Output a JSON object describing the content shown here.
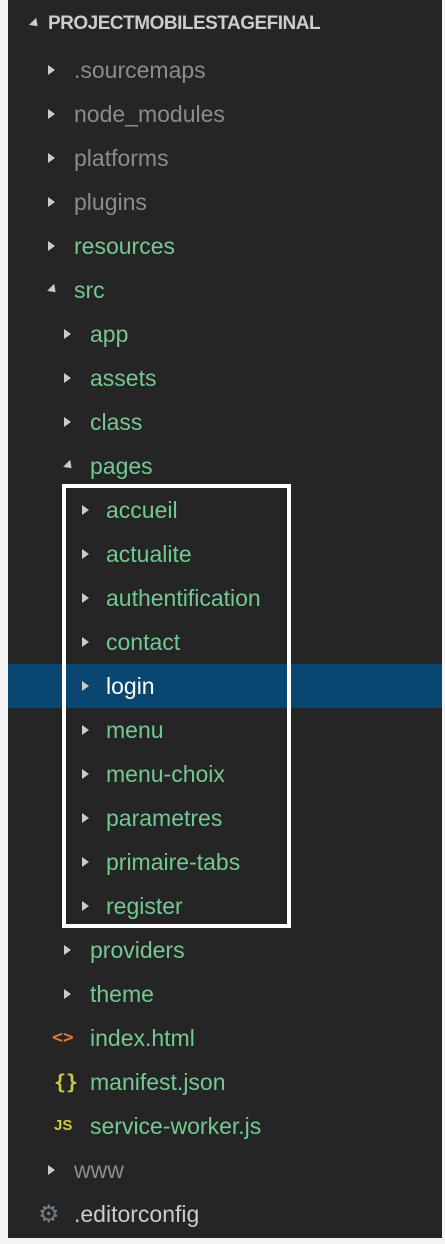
{
  "explorer": {
    "project_name": "PROJECTMOBILESTAGEFINAL",
    "items": {
      "sourcemaps": ".sourcemaps",
      "node_modules": "node_modules",
      "platforms": "platforms",
      "plugins": "plugins",
      "resources": "resources",
      "src": "src",
      "app": "app",
      "assets": "assets",
      "class": "class",
      "pages": "pages",
      "accueil": "accueil",
      "actualite": "actualite",
      "authentification": "authentification",
      "contact": "contact",
      "login": "login",
      "menu": "menu",
      "menu_choix": "menu-choix",
      "parametres": "parametres",
      "primaire_tabs": "primaire-tabs",
      "register": "register",
      "providers": "providers",
      "theme": "theme",
      "index_html": "index.html",
      "manifest_json": "manifest.json",
      "service_worker": "service-worker.js",
      "www": "www",
      "editorconfig": ".editorconfig"
    },
    "icons": {
      "html_glyph": "<>",
      "json_glyph": "{}",
      "js_glyph": "JS",
      "gear_glyph": "⚙"
    },
    "selected_item": "login",
    "colors": {
      "background": "#252526",
      "selection": "#094771",
      "git_untracked": "#73c991",
      "ignored": "#8c8c8c",
      "highlight_box": "#ffffff"
    }
  }
}
